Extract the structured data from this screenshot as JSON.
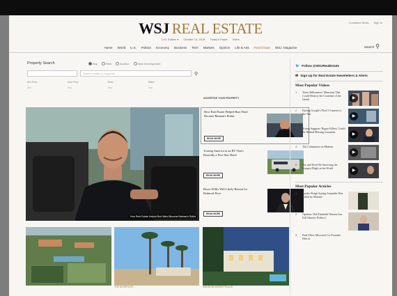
{
  "header": {
    "utility": [
      "Locations News",
      "Sign In"
    ],
    "brand_wsj": "WSJ",
    "brand_section": "REAL ESTATE",
    "edition": [
      "U.S. Edition ▾",
      "October 14, 2018",
      "Today's Paper",
      "Video"
    ],
    "nav": [
      "Home",
      "World",
      "U.S.",
      "Politics",
      "Economy",
      "Business",
      "Tech",
      "Markets",
      "Opinion",
      "Life & Arts",
      "Real Estate",
      "WSJ. Magazine"
    ],
    "nav_active_index": 10,
    "search_label": "Search"
  },
  "property_search": {
    "title": "Property Search",
    "radios": [
      "Buy",
      "Rent",
      "Auction",
      "New Development"
    ],
    "selected_radio": 0,
    "location_placeholder": "Search Location or Keywords",
    "filter_row": [
      "Min Price",
      "Max Price",
      "Beds",
      "Baths"
    ],
    "filter_values": [
      "Any",
      "Any",
      "Any",
      "Any"
    ]
  },
  "advertising_label": "ADVERTISE YOUR PROPERTY",
  "hero": {
    "caption": "How Real Estate Helped Burt Ward Become Batman's Robin"
  },
  "stories": [
    {
      "title": "How Real Estate Helped Burt Ward Become Batman's Robin",
      "button": "READ MORE"
    },
    {
      "title": "Touring America in an RV That's Basically a Five-Star Hotel",
      "button": "READ MORE"
    },
    {
      "title": "Bruce Willis Will Likely Retreat for Reduced Price",
      "button": "READ MORE"
    }
  ],
  "right_rail": {
    "follow": "Follow @WSJRealEstate",
    "newsletter": "Sign Up for Real Estate Newsletters & Alerts",
    "videos_heading": "Most Popular Videos",
    "videos": [
      {
        "num": "1",
        "title": "Three Billionaires' Mansions That Could Destroy the Coastline of the Island"
      },
      {
        "num": "2",
        "title": "Putting Google's Pixel 3 Camera to the Test"
      },
      {
        "num": "3",
        "title": "Trump Suggests 'Rogue Killers' Could Be Behind Missing Journalist"
      },
      {
        "num": "4",
        "title": "The Columnists on Mideast"
      },
      {
        "num": "5",
        "title": "See and Don't Be Surviving the Longest Flight in the World"
      }
    ],
    "articles_heading": "Most Popular Articles",
    "articles": [
      {
        "num": "1",
        "title": "Saudis Weigh Saying Journalist Was Killed by Mistake"
      },
      {
        "num": "2",
        "title": "Opinion: Did Elizabeth Warren Just Kill Identity Politics?"
      },
      {
        "num": "3",
        "title": "Paul Allen, Microsoft Co-Founder, Dies at"
      }
    ]
  },
  "bottom_labels": [
    "",
    "THE SHORTLIST",
    "MANSION MARKETPLACE"
  ]
}
